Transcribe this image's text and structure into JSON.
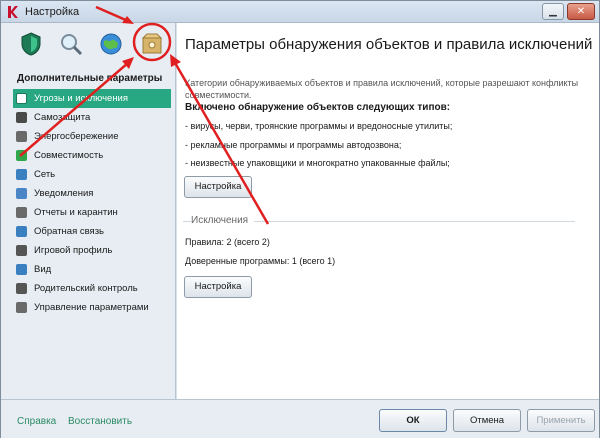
{
  "window": {
    "title": "Настройка"
  },
  "toolbar": {
    "icons": [
      "shield-icon",
      "magnifier-icon",
      "globe-icon",
      "box-icon"
    ]
  },
  "sidebar": {
    "heading": "Дополнительные параметры",
    "items": [
      {
        "label": "Угрозы и исключения",
        "selected": true,
        "icon": "threats-icon",
        "color": "#ffffff"
      },
      {
        "label": "Самозащита",
        "icon": "selfdefense-icon",
        "color": "#4a4a4a"
      },
      {
        "label": "Энергосбережение",
        "icon": "battery-icon",
        "color": "#6a6a6a"
      },
      {
        "label": "Совместимость",
        "icon": "compatibility-icon",
        "color": "#2fa64a"
      },
      {
        "label": "Сеть",
        "icon": "network-icon",
        "color": "#3a7fc0"
      },
      {
        "label": "Уведомления",
        "icon": "notify-icon",
        "color": "#4a86c6"
      },
      {
        "label": "Отчеты и карантин",
        "icon": "reports-icon",
        "color": "#6a6a6a"
      },
      {
        "label": "Обратная связь",
        "icon": "feedback-icon",
        "color": "#3a7fc0"
      },
      {
        "label": "Игровой профиль",
        "icon": "gamepad-icon",
        "color": "#555555"
      },
      {
        "label": "Вид",
        "icon": "view-icon",
        "color": "#3a7fc0"
      },
      {
        "label": "Родительский контроль",
        "icon": "parental-icon",
        "color": "#555555"
      },
      {
        "label": "Управление параметрами",
        "icon": "settings-icon",
        "color": "#6a6a6a"
      }
    ]
  },
  "main": {
    "title": "Параметры обнаружения объектов и правила исключений",
    "description": "Категории обнаруживаемых объектов и правила исключений, которые разрешают конфликты совместимости.",
    "section_title": "Включено обнаружение объектов следующих типов:",
    "bullets": [
      "- вирусы, черви, троянские программы и вредоносные утилиты;",
      "- рекламные программы и программы автодозвона;",
      "- неизвестные упаковщики и многократно упакованные файлы;"
    ],
    "setup_button_1": "Настройка",
    "exclusions_label": "Исключения",
    "rules": "Правила: 2 (всего 2)",
    "trusted": "Доверенные программы: 1 (всего 1)",
    "setup_button_2": "Настройка"
  },
  "footer": {
    "help_link": "Справка",
    "restore_link": "Восстановить",
    "ok_button": "ОК",
    "cancel_button": "Отмена",
    "apply_button": "Применить"
  },
  "colors": {
    "accent": "#27a882",
    "annotation": "#e02020"
  }
}
